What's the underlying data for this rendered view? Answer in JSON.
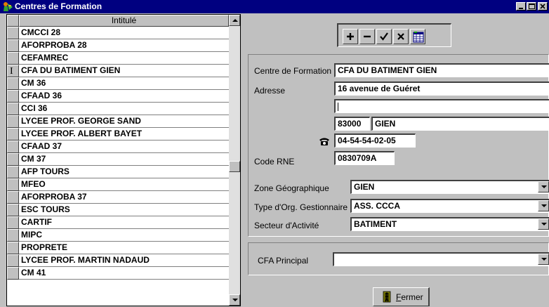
{
  "window": {
    "title": "Centres de Formation",
    "minimize_label": "_",
    "maximize_label": "□",
    "close_label": "×"
  },
  "grid": {
    "column_header": "Intitulé",
    "current_row": 3,
    "rows": [
      "CMCCI 28",
      "AFORPROBA 28",
      "CEFAMREC",
      "CFA DU BATIMENT GIEN",
      "CM 36",
      "CFAAD 36",
      "CCI 36",
      "LYCEE PROF. GEORGE SAND",
      "LYCEE PROF. ALBERT BAYET",
      "CFAAD 37",
      "CM 37",
      "AFP TOURS",
      "MFEO",
      "AFORPROBA 37",
      "ESC TOURS",
      "CARTIF",
      "MIPC",
      "PROPRETE",
      "LYCEE PROF. MARTIN NADAUD",
      "CM 41"
    ]
  },
  "toolbar": {
    "add_icon": "plus-icon",
    "delete_icon": "minus-icon",
    "confirm_icon": "check-icon",
    "cancel_icon": "x-icon",
    "table_icon": "table-icon"
  },
  "form": {
    "centre_label": "Centre de Formation",
    "centre_value": "CFA DU BATIMENT GIEN",
    "adresse_label": "Adresse",
    "adresse1_value": "16 avenue de Guéret",
    "adresse2_value": "",
    "cp_value": "83000",
    "ville_value": "GIEN",
    "phone_icon": "telephone-icon",
    "phone_value": "04-54-54-02-05",
    "rne_label": "Code RNE",
    "rne_value": "0830709A",
    "zone_label": "Zone Géographique",
    "zone_value": "GIEN",
    "type_label": "Type d'Org. Gestionnaire",
    "type_value": "ASS. CCCA",
    "secteur_label": "Secteur d'Activité",
    "secteur_value": "BATIMENT",
    "principal_label": "CFA Principal",
    "principal_value": ""
  },
  "footer": {
    "fermer_label": "Fermer",
    "fermer_icon": "exit-door-icon"
  }
}
